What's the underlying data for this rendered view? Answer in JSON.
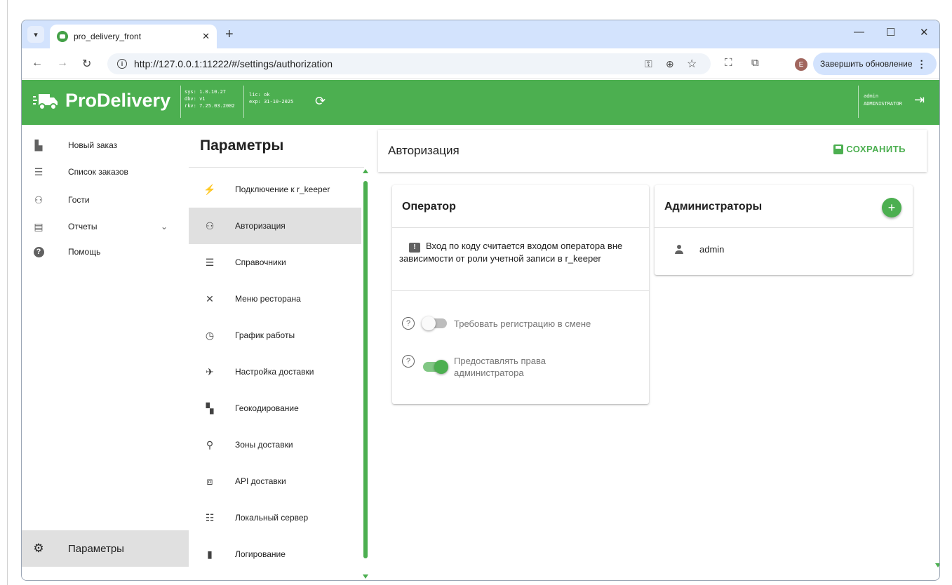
{
  "browser": {
    "tab_title": "pro_delivery_front",
    "url": "http://127.0.0.1:11222/#/settings/authorization",
    "update_label": "Завершить обновление",
    "profile_initial": "E"
  },
  "header": {
    "brand": "ProDelivery",
    "sys_lines": [
      "sys: 1.0.10.27",
      "dbv: v1",
      "rkv: 7.25.03.2002"
    ],
    "lic_lines": [
      "lic: ok",
      "exp:  31-10-2025"
    ],
    "user_name": "admin",
    "user_role": "ADMINISTRATOR"
  },
  "sidebar": {
    "items": [
      {
        "label": "Новый заказ",
        "icon": "new-order-icon"
      },
      {
        "label": "Список заказов",
        "icon": "list-icon"
      },
      {
        "label": "Гости",
        "icon": "guests-icon"
      },
      {
        "label": "Отчеты",
        "icon": "reports-icon"
      },
      {
        "label": "Помощь",
        "icon": "help-icon"
      }
    ],
    "settings_label": "Параметры"
  },
  "params": {
    "title": "Параметры",
    "items": [
      {
        "label": "Подключение к r_keeper",
        "icon": "plug-icon"
      },
      {
        "label": "Авторизация",
        "icon": "people-icon",
        "active": true
      },
      {
        "label": "Справочники",
        "icon": "list-icon"
      },
      {
        "label": "Меню ресторана",
        "icon": "cutlery-icon"
      },
      {
        "label": "График работы",
        "icon": "clock-icon"
      },
      {
        "label": "Настройка доставки",
        "icon": "delivery-settings-icon"
      },
      {
        "label": "Геокодирование",
        "icon": "map-search-icon"
      },
      {
        "label": "Зоны доставки",
        "icon": "location-icon"
      },
      {
        "label": "API доставки",
        "icon": "api-icon"
      },
      {
        "label": "Локальный сервер",
        "icon": "server-icon"
      },
      {
        "label": "Логирование",
        "icon": "log-icon"
      }
    ]
  },
  "main": {
    "title": "Авторизация",
    "save_label": "СОХРАНИТЬ",
    "operator": {
      "title": "Оператор",
      "info": "Вход по коду считается входом оператора вне зависимости от роли учетной записи в r_keeper",
      "options": [
        {
          "label": "Требовать регистрацию в смене",
          "enabled": false
        },
        {
          "label": "Предоставлять права администратора",
          "enabled": true
        }
      ]
    },
    "admins": {
      "title": "Администраторы",
      "add_label": "+",
      "users": [
        "admin"
      ]
    }
  },
  "colors": {
    "accent": "#4caf50",
    "accent_light": "#81c784",
    "browser_chrome": "#d3e3fd"
  }
}
